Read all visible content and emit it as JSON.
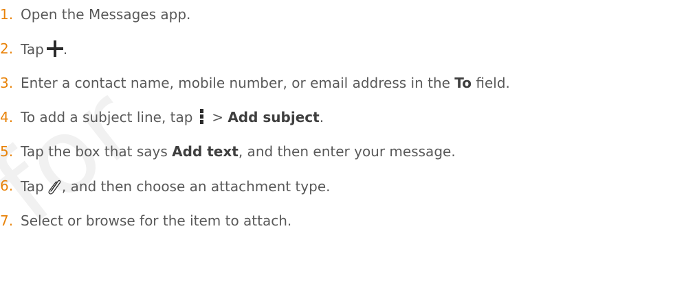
{
  "watermark": {
    "line1": "F",
    "line2": "for"
  },
  "steps": [
    {
      "number": "1.",
      "text": "Open the Messages app."
    },
    {
      "number": "2.",
      "before": "Tap",
      "icon": "plus-icon",
      "after": "."
    },
    {
      "number": "3.",
      "before": "Enter a contact name, mobile number, or email address in the",
      "term": "To",
      "after": "field."
    },
    {
      "number": "4.",
      "before": "To add a subject line, tap",
      "icon": "more-vertical-icon",
      "separator": ">",
      "term": "Add subject",
      "after": "."
    },
    {
      "number": "5.",
      "before": "Tap the box that says",
      "term": "Add text",
      "after": ", and then enter your message."
    },
    {
      "number": "6.",
      "before": "Tap",
      "icon": "paperclip-icon",
      "after": ", and then choose an attachment type."
    },
    {
      "number": "7.",
      "text": "Select or browse for the item to attach."
    }
  ],
  "colors": {
    "number": "#e8830a",
    "text": "#595959",
    "term": "#3f3f3f",
    "icon": "#2b2b2b",
    "watermark": "#f1f1f1"
  }
}
